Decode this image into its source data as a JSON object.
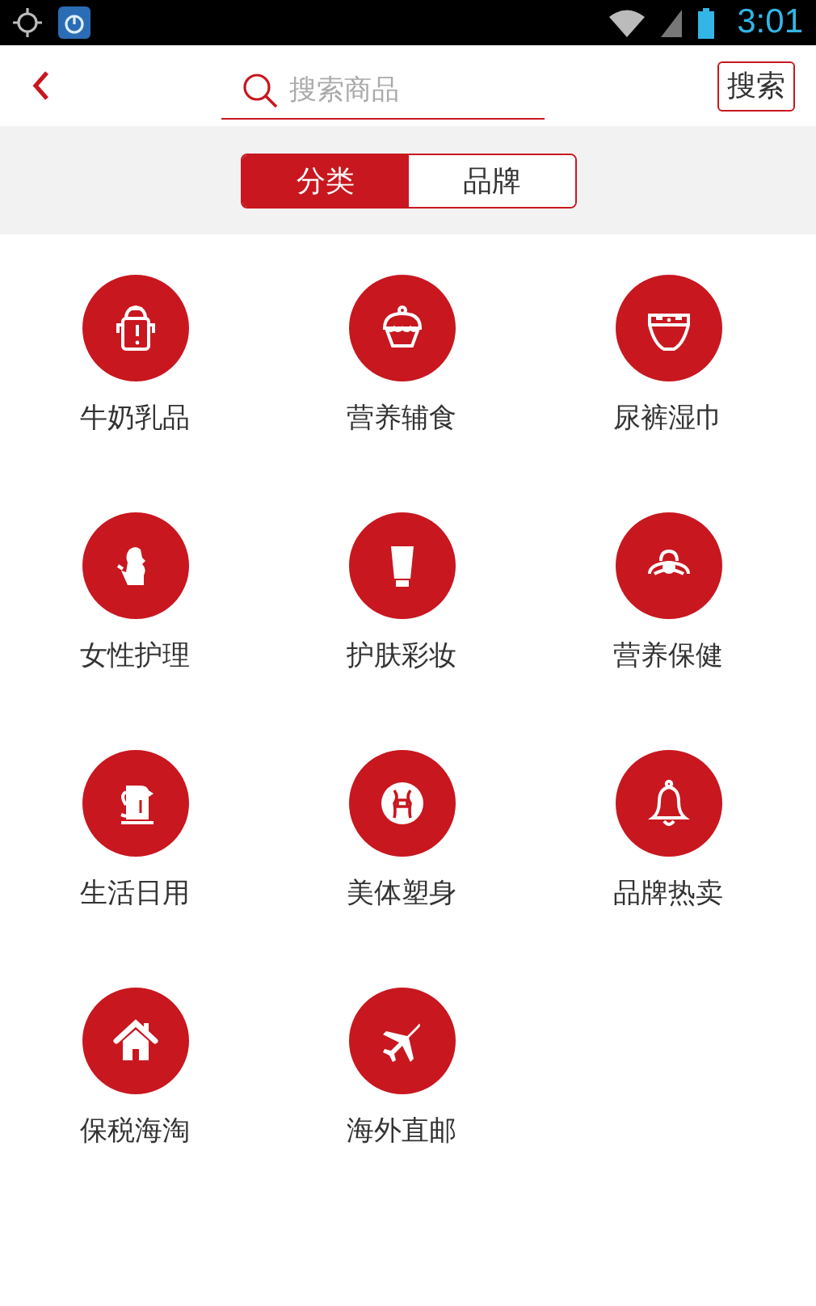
{
  "status_bar": {
    "time": "3:01"
  },
  "header": {
    "search": {
      "placeholder": "搜索商品"
    },
    "search_button": "搜索"
  },
  "tabs": [
    {
      "label": "分类",
      "selected": true
    },
    {
      "label": "品牌",
      "selected": false
    }
  ],
  "categories": [
    {
      "label": "牛奶乳品"
    },
    {
      "label": "营养辅食"
    },
    {
      "label": "尿裤湿巾"
    },
    {
      "label": "女性护理"
    },
    {
      "label": "护肤彩妆"
    },
    {
      "label": "营养保健"
    },
    {
      "label": "生活日用"
    },
    {
      "label": "美体塑身"
    },
    {
      "label": "品牌热卖"
    },
    {
      "label": "保税海淘"
    },
    {
      "label": "海外直邮"
    }
  ]
}
